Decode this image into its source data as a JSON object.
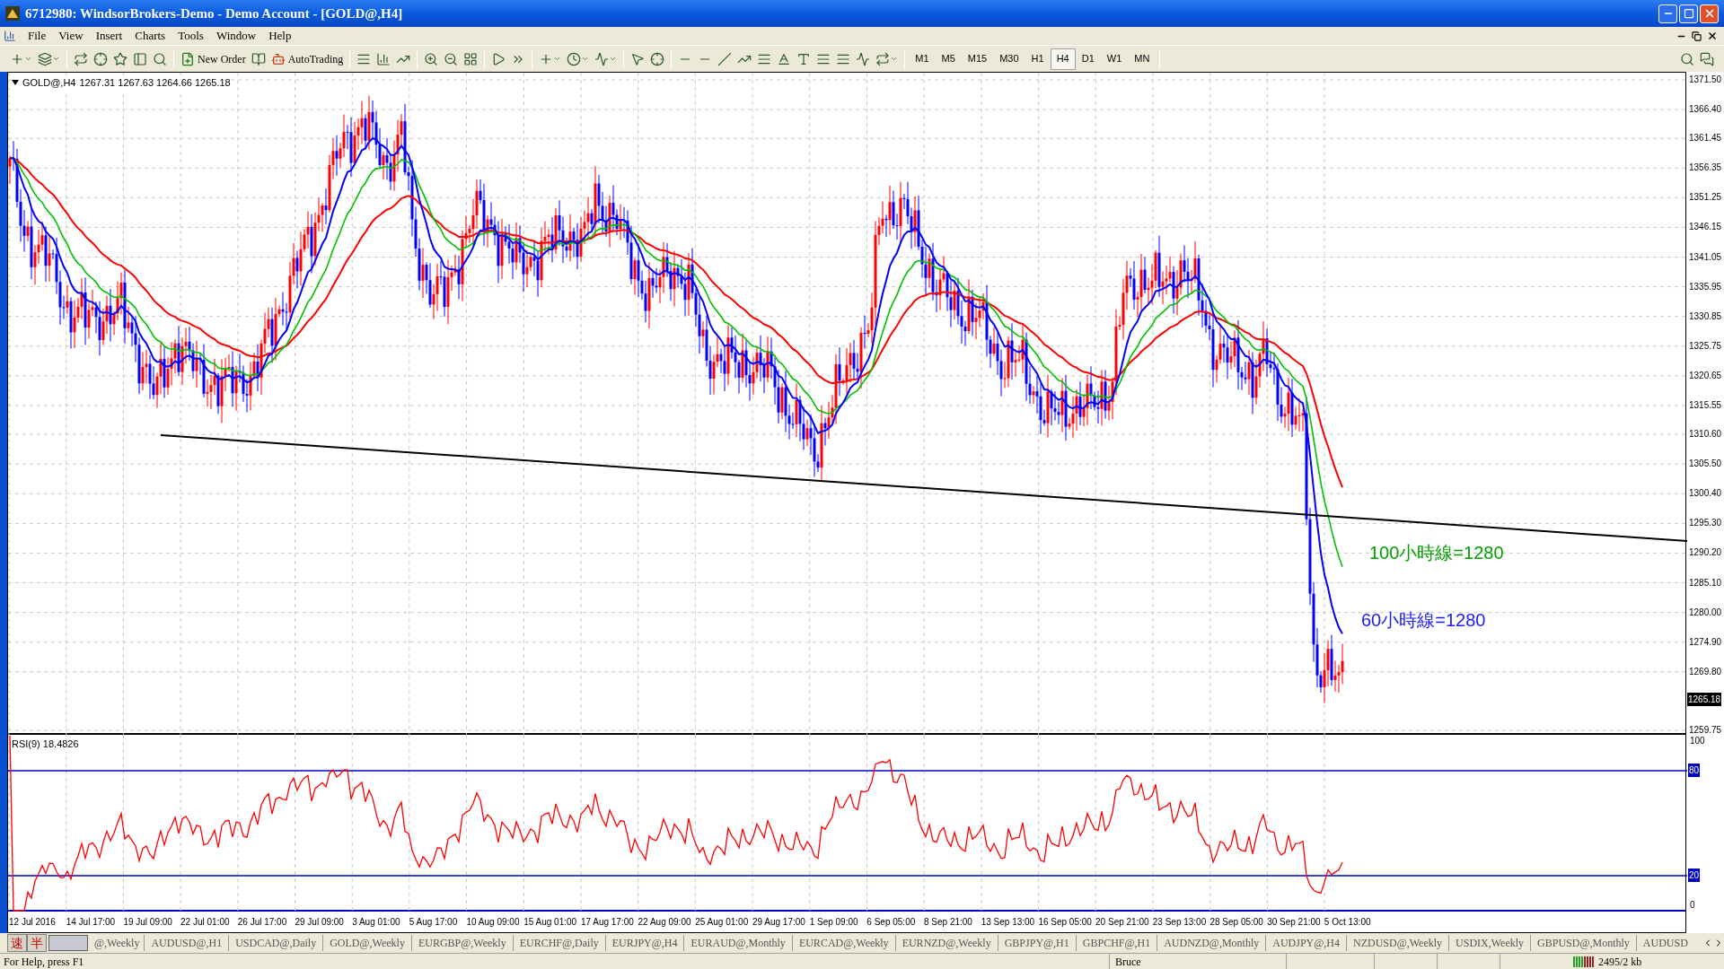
{
  "window": {
    "title": "6712980: WindsorBrokers-Demo - Demo Account - [GOLD@,H4]"
  },
  "menu": [
    "File",
    "View",
    "Insert",
    "Charts",
    "Tools",
    "Window",
    "Help"
  ],
  "toolbar": {
    "new_order": "New Order",
    "auto_trading": "AutoTrading",
    "timeframes": [
      {
        "label": "M1",
        "selected": false
      },
      {
        "label": "M5",
        "selected": false
      },
      {
        "label": "M15",
        "selected": false
      },
      {
        "label": "M30",
        "selected": false
      },
      {
        "label": "H1",
        "selected": false
      },
      {
        "label": "H4",
        "selected": true
      },
      {
        "label": "D1",
        "selected": false
      },
      {
        "label": "W1",
        "selected": false
      },
      {
        "label": "MN",
        "selected": false
      }
    ]
  },
  "chart": {
    "symbol": "GOLD@,H4",
    "ohlc": "1267.31 1267.63 1264.66 1265.18",
    "price_axis": [
      "1371.50",
      "1366.40",
      "1361.45",
      "1356.35",
      "1351.25",
      "1346.15",
      "1341.05",
      "1335.95",
      "1330.85",
      "1325.75",
      "1320.65",
      "1315.55",
      "1310.60",
      "1305.50",
      "1300.40",
      "1295.30",
      "1290.20",
      "1285.10",
      "1280.00",
      "1274.90",
      "1269.80",
      "1259.75"
    ],
    "current_price": "1265.18",
    "annotations": [
      {
        "text": "100小時線=1280",
        "color": "#00a000"
      },
      {
        "text": "60小時線=1280",
        "color": "#1a1aff"
      }
    ]
  },
  "rsi": {
    "label": "RSI(9) 18.4826",
    "scale": [
      "100",
      "80",
      "20",
      "0"
    ]
  },
  "time_axis": [
    "12 Jul 2016",
    "14 Jul 17:00",
    "19 Jul 09:00",
    "22 Jul 01:00",
    "26 Jul 17:00",
    "29 Jul 09:00",
    "3 Aug 01:00",
    "5 Aug 17:00",
    "10 Aug 09:00",
    "15 Aug 01:00",
    "17 Aug 17:00",
    "22 Aug 09:00",
    "25 Aug 01:00",
    "29 Aug 17:00",
    "1 Sep 09:00",
    "6 Sep 05:00",
    "8 Sep 21:00",
    "13 Sep 13:00",
    "16 Sep 05:00",
    "20 Sep 21:00",
    "23 Sep 13:00",
    "28 Sep 05:00",
    "30 Sep 21:00",
    "5 Oct 13:00"
  ],
  "ime": [
    "速",
    "半"
  ],
  "tabs": [
    "@,Weekly",
    "AUDUSD@,H1",
    "USDCAD@,Daily",
    "GOLD@,Weekly",
    "EURGBP@,Weekly",
    "EURCHF@,Daily",
    "EURJPY@,H4",
    "EURAUD@,Monthly",
    "EURCAD@,Weekly",
    "EURNZD@,Weekly",
    "GBPJPY@,H1",
    "GBPCHF@,H1",
    "AUDNZD@,Monthly",
    "AUDJPY@,H4",
    "NZDUSD@,Weekly",
    "USDIX,Weekly",
    "GBPUSD@,Monthly",
    "AUDUSD"
  ],
  "status_bar": {
    "help": "For Help, press F1",
    "profile": "Bruce",
    "traffic": "2495/2 kb"
  }
}
